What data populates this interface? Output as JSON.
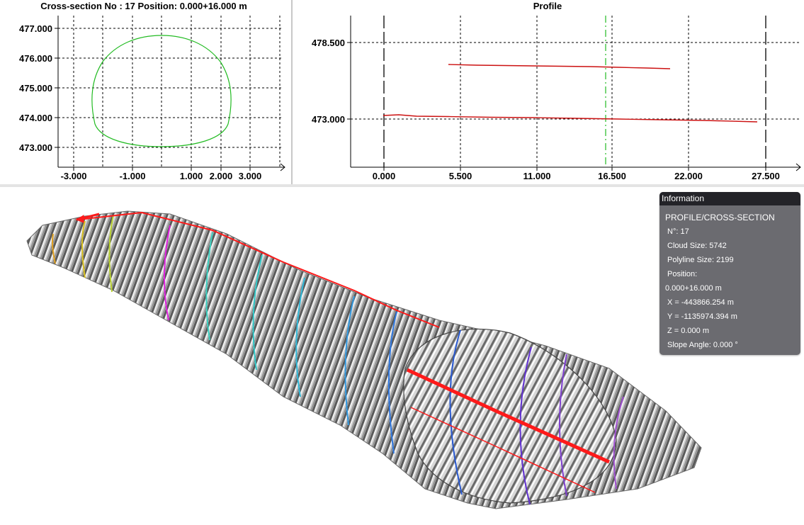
{
  "cross_section_panel": {
    "title": "Cross-section No : 17    Position: 0.000+16.000 m",
    "y_ticks": [
      "477.000",
      "476.000",
      "475.000",
      "474.000",
      "473.000"
    ],
    "x_ticks": [
      "-3.000",
      "-1.000",
      "1.000",
      "2.000",
      "3.000"
    ],
    "curve_color": "#22bb22"
  },
  "profile_panel": {
    "title": "Profile",
    "y_ticks": [
      "478.500",
      "473.000"
    ],
    "x_ticks": [
      "0.000",
      "5.500",
      "11.000",
      "16.500",
      "22.000",
      "27.500"
    ],
    "line_color": "#cc1111",
    "marker_color": "#22bb22"
  },
  "info": {
    "header": "Information",
    "title": "PROFILE/CROSS-SECTION",
    "number": "N°: 17",
    "cloud_size": "Cloud Size: 5742",
    "polyline_size": "Polyline Size: 2199",
    "position_label": "Position:",
    "position_value": "0.000+16.000 m",
    "x": "X = -443866.254 m",
    "y": "Y = -1135974.394 m",
    "z": "Z = 0.000 m",
    "slope": "Slope Angle: 0.000 °"
  },
  "colors": {
    "profile_polyline": "#ff1a1a",
    "panel_bg": "#6b6b70",
    "panel_header": "#232328"
  }
}
